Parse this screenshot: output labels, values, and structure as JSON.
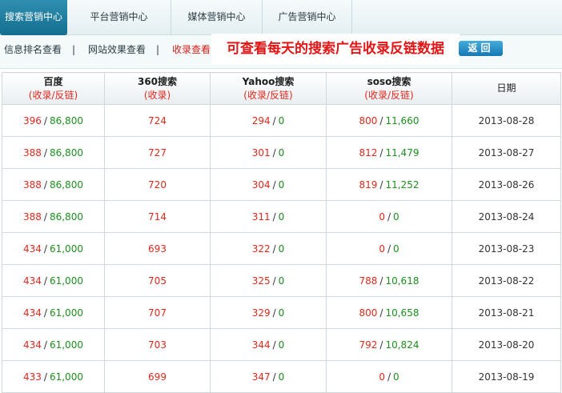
{
  "topnav": {
    "tabs": [
      {
        "label": "搜索营销中心",
        "active": true
      },
      {
        "label": "平台营销中心",
        "active": false
      },
      {
        "label": "媒体营销中心",
        "active": false
      },
      {
        "label": "广告营销中心",
        "active": false
      }
    ]
  },
  "subnav": {
    "links": [
      {
        "label": "信息排名查看",
        "active": false
      },
      {
        "label": "网站效果查看",
        "active": false
      },
      {
        "label": "收录查看",
        "active": true
      }
    ],
    "separator": "|",
    "banner": "可查看每天的搜索广告收录反链数据",
    "back_label": "返回"
  },
  "table": {
    "headers": [
      {
        "name": "百度",
        "sub": "(收录/反链)"
      },
      {
        "name": "360搜索",
        "sub": "(收录)"
      },
      {
        "name": "Yahoo搜索",
        "sub": "(收录/反链)"
      },
      {
        "name": "soso搜索",
        "sub": "(收录/反链)"
      },
      {
        "name": "日期",
        "sub": ""
      }
    ],
    "slash": "/",
    "rows": [
      {
        "baidu_index": "396",
        "baidu_links": "86,800",
        "s360": "724",
        "yahoo_index": "294",
        "yahoo_links": "0",
        "soso_index": "800",
        "soso_links": "11,660",
        "date": "2013-08-28"
      },
      {
        "baidu_index": "388",
        "baidu_links": "86,800",
        "s360": "727",
        "yahoo_index": "301",
        "yahoo_links": "0",
        "soso_index": "812",
        "soso_links": "11,479",
        "date": "2013-08-27"
      },
      {
        "baidu_index": "388",
        "baidu_links": "86,800",
        "s360": "720",
        "yahoo_index": "304",
        "yahoo_links": "0",
        "soso_index": "819",
        "soso_links": "11,252",
        "date": "2013-08-26"
      },
      {
        "baidu_index": "388",
        "baidu_links": "86,800",
        "s360": "714",
        "yahoo_index": "311",
        "yahoo_links": "0",
        "soso_index": "0",
        "soso_links": "0",
        "date": "2013-08-24"
      },
      {
        "baidu_index": "434",
        "baidu_links": "61,000",
        "s360": "693",
        "yahoo_index": "322",
        "yahoo_links": "0",
        "soso_index": "0",
        "soso_links": "0",
        "date": "2013-08-23"
      },
      {
        "baidu_index": "434",
        "baidu_links": "61,000",
        "s360": "705",
        "yahoo_index": "325",
        "yahoo_links": "0",
        "soso_index": "788",
        "soso_links": "10,618",
        "date": "2013-08-22"
      },
      {
        "baidu_index": "434",
        "baidu_links": "61,000",
        "s360": "707",
        "yahoo_index": "329",
        "yahoo_links": "0",
        "soso_index": "800",
        "soso_links": "10,658",
        "date": "2013-08-21"
      },
      {
        "baidu_index": "434",
        "baidu_links": "61,000",
        "s360": "703",
        "yahoo_index": "344",
        "yahoo_links": "0",
        "soso_index": "792",
        "soso_links": "10,824",
        "date": "2013-08-20"
      },
      {
        "baidu_index": "433",
        "baidu_links": "61,000",
        "s360": "699",
        "yahoo_index": "347",
        "yahoo_links": "0",
        "soso_index": "0",
        "soso_links": "0",
        "date": "2013-08-19"
      }
    ]
  },
  "colors": {
    "index_value": "#e0281c",
    "links_value": "#1c8f1c",
    "active_tab": "#1e7fa2",
    "banner_text": "#e21616"
  }
}
